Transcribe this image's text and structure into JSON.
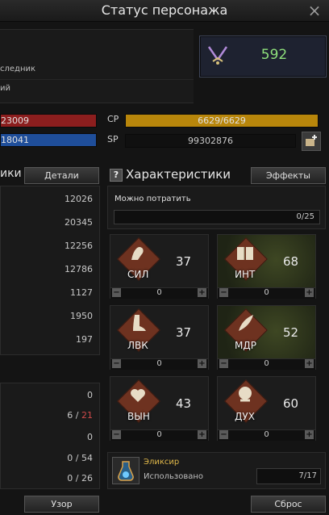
{
  "window": {
    "title": "Статус персонажа",
    "close_glyph": "×"
  },
  "character": {
    "line1": "следник",
    "line2": "ий"
  },
  "combat_power": {
    "icon": "swords-icon",
    "value": "592"
  },
  "bars": {
    "hp": {
      "value": "23009",
      "color": "#8c1e1e"
    },
    "mp": {
      "value": "18041",
      "color": "#1f4e9a"
    },
    "cp": {
      "label": "CP",
      "value": "6629/6629",
      "color": "#b8860b"
    },
    "sp": {
      "label": "SP",
      "value": "99302876"
    }
  },
  "left_panel": {
    "title_partial": "ики",
    "details_button": "Детали",
    "values": [
      "12026",
      "20345",
      "12256",
      "12786",
      "1127",
      "1950",
      "197"
    ]
  },
  "left_bottom": {
    "values": [
      "0",
      "6 / ",
      "21",
      "0",
      "0 / 54",
      "0 / 26"
    ]
  },
  "stats_header": {
    "help_glyph": "?",
    "title": "Характеристики",
    "effects_button": "Эффекты"
  },
  "spendable": {
    "label": "Можно потратить",
    "value": "0/25"
  },
  "stats": [
    {
      "abbr": "СИЛ",
      "value": "37",
      "alloc": "0",
      "icon": "arm-icon"
    },
    {
      "abbr": "ИНТ",
      "value": "68",
      "alloc": "0",
      "icon": "book-icon"
    },
    {
      "abbr": "ЛВК",
      "value": "37",
      "alloc": "0",
      "icon": "foot-icon"
    },
    {
      "abbr": "МДР",
      "value": "52",
      "alloc": "0",
      "icon": "feather-icon"
    },
    {
      "abbr": "ВЫН",
      "value": "43",
      "alloc": "0",
      "icon": "heart-icon"
    },
    {
      "abbr": "ДУХ",
      "value": "60",
      "alloc": "0",
      "icon": "head-icon"
    }
  ],
  "elixir": {
    "title": "Эликсир",
    "used_label": "Использовано",
    "used_value": "7/17"
  },
  "footer": {
    "pattern_button": "Узор",
    "reset_button": "Сброс"
  }
}
